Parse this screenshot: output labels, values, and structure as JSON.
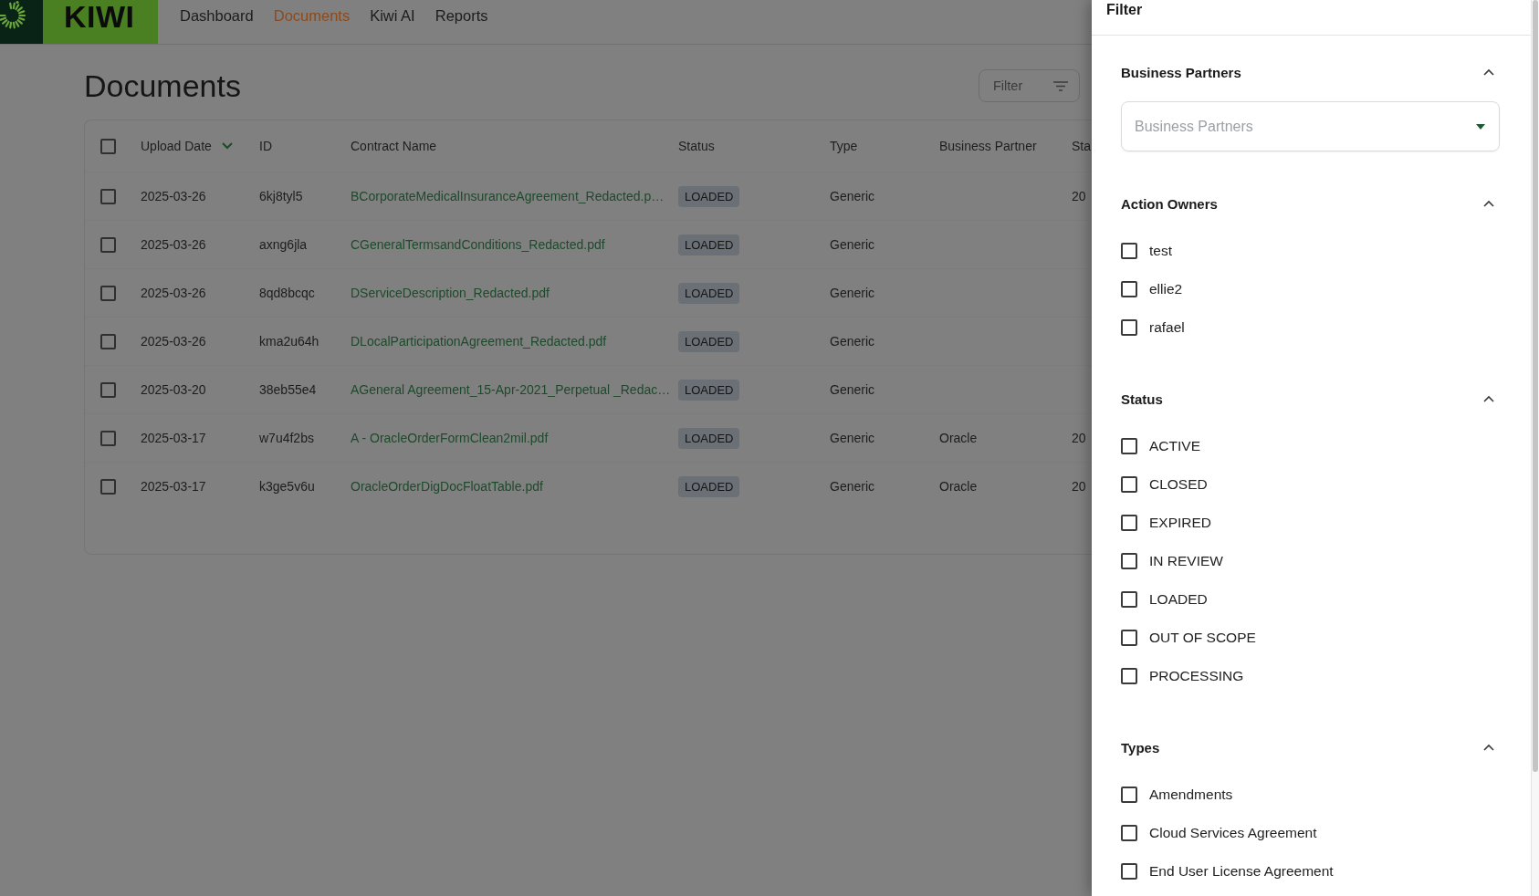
{
  "header": {
    "logo": {
      "text": "KIWI"
    },
    "nav": [
      {
        "label": "Dashboard",
        "selected": false
      },
      {
        "label": "Documents",
        "selected": true
      },
      {
        "label": "Kiwi AI",
        "selected": false
      },
      {
        "label": "Reports",
        "selected": false
      }
    ]
  },
  "page": {
    "title": "Documents",
    "filter_button": {
      "label": "Filter"
    },
    "table": {
      "select_all_checked": false,
      "columns": [
        {
          "label": "Upload Date",
          "sorted": true
        },
        {
          "label": "ID",
          "sorted": false
        },
        {
          "label": "Contract Name",
          "sorted": false
        },
        {
          "label": "Status",
          "sorted": false
        },
        {
          "label": "Type",
          "sorted": false
        },
        {
          "label": "Business Partner",
          "sorted": false
        },
        {
          "label": "Sta",
          "sorted": false
        }
      ],
      "rows": [
        {
          "checked": false,
          "upload_date": "2025-03-26",
          "id": "6kj8tyl5",
          "contract_name": "BCorporateMedicalInsuranceAgreement_Redacted.p…",
          "status": "LOADED",
          "type": "Generic",
          "column_7": "20"
        },
        {
          "checked": false,
          "upload_date": "2025-03-26",
          "id": "axng6jla",
          "contract_name": "CGeneralTermsandConditions_Redacted.pdf",
          "status": "LOADED",
          "type": "Generic"
        },
        {
          "checked": false,
          "upload_date": "2025-03-26",
          "id": "8qd8bcqc",
          "contract_name": "DServiceDescription_Redacted.pdf",
          "status": "LOADED",
          "type": "Generic"
        },
        {
          "checked": false,
          "upload_date": "2025-03-26",
          "id": "kma2u64h",
          "contract_name": "DLocalParticipationAgreement_Redacted.pdf",
          "status": "LOADED",
          "type": "Generic"
        },
        {
          "checked": false,
          "upload_date": "2025-03-20",
          "id": "38eb55e4",
          "contract_name": "AGeneral Agreement_15-Apr-2021_Perpetual _Redac…",
          "status": "LOADED",
          "type": "Generic"
        },
        {
          "checked": false,
          "upload_date": "2025-03-17",
          "id": "w7u4f2bs",
          "contract_name": "A - OracleOrderFormClean2mil.pdf",
          "status": "LOADED",
          "type": "Generic",
          "business_partner": "Oracle",
          "column_7": "20"
        },
        {
          "checked": false,
          "upload_date": "2025-03-17",
          "id": "k3ge5v6u",
          "contract_name": "OracleOrderDigDocFloatTable.pdf",
          "status": "LOADED",
          "type": "Generic",
          "business_partner": "Oracle",
          "column_7": "20"
        }
      ]
    }
  },
  "filter_panel": {
    "title": "Filter",
    "sections": [
      {
        "kind": "dropdown",
        "title": "Business Partners",
        "expanded": true,
        "placeholder": "Business Partners"
      },
      {
        "kind": "checklist",
        "title": "Action Owners",
        "expanded": true,
        "options": [
          {
            "label": "test",
            "checked": false
          },
          {
            "label": "ellie2",
            "checked": false
          },
          {
            "label": "rafael",
            "checked": false
          }
        ]
      },
      {
        "kind": "checklist",
        "title": "Status",
        "expanded": true,
        "options": [
          {
            "label": "ACTIVE",
            "checked": false
          },
          {
            "label": "CLOSED",
            "checked": false
          },
          {
            "label": "EXPIRED",
            "checked": false
          },
          {
            "label": "IN REVIEW",
            "checked": false
          },
          {
            "label": "LOADED",
            "checked": false
          },
          {
            "label": "OUT OF SCOPE",
            "checked": false
          },
          {
            "label": "PROCESSING",
            "checked": false
          }
        ]
      },
      {
        "kind": "checklist",
        "title": "Types",
        "expanded": true,
        "options": [
          {
            "label": "Amendments",
            "checked": false
          },
          {
            "label": "Cloud Services Agreement",
            "checked": false
          },
          {
            "label": "End User License Agreement",
            "checked": false
          }
        ]
      }
    ]
  }
}
